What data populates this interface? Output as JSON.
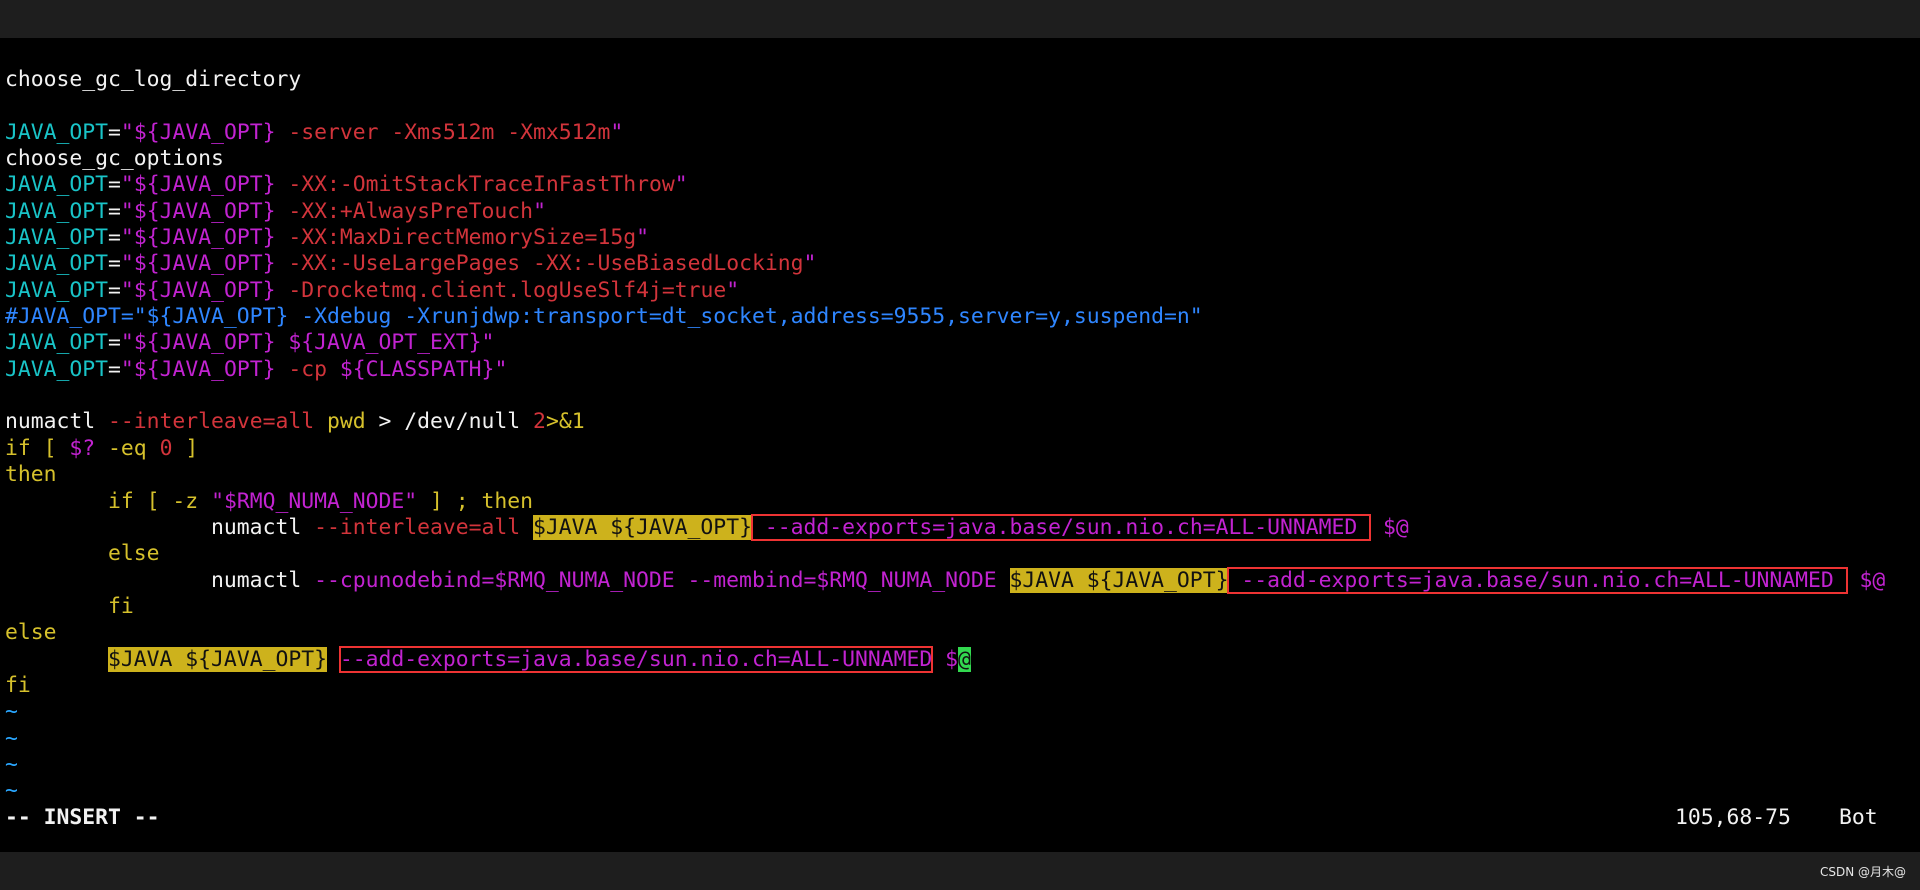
{
  "colors": {
    "background": "#000000",
    "top_bar": "#1e1e1e",
    "cyan": "#19c4c8",
    "magenta": "#c223d1",
    "red": "#d2343b",
    "yellow": "#d6c12c",
    "blue": "#2f86ff",
    "highlight": "#cdb21c",
    "box": "#ff3333",
    "cursor": "#32d94f"
  },
  "editor": {
    "lines": [
      [
        {
          "t": "choose_gc_log_directory",
          "c": "white"
        }
      ],
      [],
      [
        {
          "t": "JAVA_OPT",
          "c": "cyan"
        },
        {
          "t": "=",
          "c": "white"
        },
        {
          "t": "\"",
          "c": "magenta"
        },
        {
          "t": "${JAVA_OPT}",
          "c": "magenta"
        },
        {
          "t": " -server -Xms512m -Xmx512m",
          "c": "red"
        },
        {
          "t": "\"",
          "c": "magenta"
        }
      ],
      [
        {
          "t": "choose_gc_options",
          "c": "white"
        }
      ],
      [
        {
          "t": "JAVA_OPT",
          "c": "cyan"
        },
        {
          "t": "=",
          "c": "white"
        },
        {
          "t": "\"",
          "c": "magenta"
        },
        {
          "t": "${JAVA_OPT}",
          "c": "magenta"
        },
        {
          "t": " -XX:-OmitStackTraceInFastThrow",
          "c": "red"
        },
        {
          "t": "\"",
          "c": "magenta"
        }
      ],
      [
        {
          "t": "JAVA_OPT",
          "c": "cyan"
        },
        {
          "t": "=",
          "c": "white"
        },
        {
          "t": "\"",
          "c": "magenta"
        },
        {
          "t": "${JAVA_OPT}",
          "c": "magenta"
        },
        {
          "t": " -XX:+AlwaysPreTouch",
          "c": "red"
        },
        {
          "t": "\"",
          "c": "magenta"
        }
      ],
      [
        {
          "t": "JAVA_OPT",
          "c": "cyan"
        },
        {
          "t": "=",
          "c": "white"
        },
        {
          "t": "\"",
          "c": "magenta"
        },
        {
          "t": "${JAVA_OPT}",
          "c": "magenta"
        },
        {
          "t": " -XX:MaxDirectMemorySize=15g",
          "c": "red"
        },
        {
          "t": "\"",
          "c": "magenta"
        }
      ],
      [
        {
          "t": "JAVA_OPT",
          "c": "cyan"
        },
        {
          "t": "=",
          "c": "white"
        },
        {
          "t": "\"",
          "c": "magenta"
        },
        {
          "t": "${JAVA_OPT}",
          "c": "magenta"
        },
        {
          "t": " -XX:-UseLargePages -XX:-UseBiasedLocking",
          "c": "red"
        },
        {
          "t": "\"",
          "c": "magenta"
        }
      ],
      [
        {
          "t": "JAVA_OPT",
          "c": "cyan"
        },
        {
          "t": "=",
          "c": "white"
        },
        {
          "t": "\"",
          "c": "magenta"
        },
        {
          "t": "${JAVA_OPT}",
          "c": "magenta"
        },
        {
          "t": " -Drocketmq.client.logUseSlf4j=true",
          "c": "red"
        },
        {
          "t": "\"",
          "c": "magenta"
        }
      ],
      [
        {
          "t": "#JAVA_OPT=\"${JAVA_OPT} -Xdebug -Xrunjdwp:transport=dt_socket,address=9555,server=y,suspend=n\"",
          "c": "blue"
        }
      ],
      [
        {
          "t": "JAVA_OPT",
          "c": "cyan"
        },
        {
          "t": "=",
          "c": "white"
        },
        {
          "t": "\"",
          "c": "magenta"
        },
        {
          "t": "${JAVA_OPT}",
          "c": "magenta"
        },
        {
          "t": " ${JAVA_OPT_EXT}",
          "c": "magenta"
        },
        {
          "t": "\"",
          "c": "magenta"
        }
      ],
      [
        {
          "t": "JAVA_OPT",
          "c": "cyan"
        },
        {
          "t": "=",
          "c": "white"
        },
        {
          "t": "\"",
          "c": "magenta"
        },
        {
          "t": "${JAVA_OPT}",
          "c": "magenta"
        },
        {
          "t": " -cp ",
          "c": "red"
        },
        {
          "t": "${CLASSPATH}",
          "c": "magenta"
        },
        {
          "t": "\"",
          "c": "magenta"
        }
      ],
      [],
      [
        {
          "t": "numactl ",
          "c": "white"
        },
        {
          "t": "--interleave=all",
          "c": "red"
        },
        {
          "t": " pwd",
          "c": "yellow"
        },
        {
          "t": " > ",
          "c": "white"
        },
        {
          "t": "/dev/null ",
          "c": "white"
        },
        {
          "t": "2",
          "c": "red"
        },
        {
          "t": ">&1",
          "c": "yellow"
        }
      ],
      [
        {
          "t": "if [ ",
          "c": "yellow"
        },
        {
          "t": "$?",
          "c": "magenta"
        },
        {
          "t": " -eq ",
          "c": "yellow"
        },
        {
          "t": "0",
          "c": "red"
        },
        {
          "t": " ]",
          "c": "yellow"
        }
      ],
      [
        {
          "t": "then",
          "c": "yellow"
        }
      ],
      [
        {
          "t": "        if [ -z ",
          "c": "yellow"
        },
        {
          "t": "\"",
          "c": "magenta"
        },
        {
          "t": "$RMQ_NUMA_NODE",
          "c": "magenta"
        },
        {
          "t": "\"",
          "c": "magenta"
        },
        {
          "t": " ] ; then",
          "c": "yellow"
        }
      ],
      [
        {
          "t": "                numactl ",
          "c": "white"
        },
        {
          "t": "--interleave=all ",
          "c": "red"
        },
        {
          "t": "$JAVA ${JAVA_OPT}",
          "c": "hl"
        },
        {
          "t": " --add-exports=java.base/sun.nio.ch=ALL-UNNAMED ",
          "c": "magenta",
          "box": true
        },
        {
          "t": " $@",
          "c": "magenta"
        }
      ],
      [
        {
          "t": "        else",
          "c": "yellow"
        }
      ],
      [
        {
          "t": "                numactl ",
          "c": "white"
        },
        {
          "t": "--cpunodebind=$RMQ_NUMA_NODE --membind=$RMQ_NUMA_NODE ",
          "c": "magenta"
        },
        {
          "t": "$JAVA ${JAVA_OPT}",
          "c": "hl"
        },
        {
          "t": " --add-exports=java.base/sun.nio.ch=ALL-UNNAMED ",
          "c": "magenta",
          "box": true
        },
        {
          "t": " $@",
          "c": "magenta"
        }
      ],
      [
        {
          "t": "        fi",
          "c": "yellow"
        }
      ],
      [
        {
          "t": "else",
          "c": "yellow"
        }
      ],
      [
        {
          "t": "        ",
          "c": "white"
        },
        {
          "t": "$JAVA ${JAVA_OPT}",
          "c": "hl"
        },
        {
          "t": " ",
          "c": "white"
        },
        {
          "t": "--add-exports=java.base/sun.nio.ch=ALL-UNNAMED",
          "c": "magenta",
          "box": true
        },
        {
          "t": " $",
          "c": "magenta"
        },
        {
          "t": "@",
          "c": "cursor"
        }
      ],
      [
        {
          "t": "fi",
          "c": "yellow"
        }
      ]
    ],
    "tilde_lines": [
      "~",
      "~",
      "~",
      "~"
    ]
  },
  "status": {
    "mode": "-- INSERT --",
    "position": "105,68-75",
    "scroll": "Bot"
  },
  "watermark": "CSDN @月木@"
}
